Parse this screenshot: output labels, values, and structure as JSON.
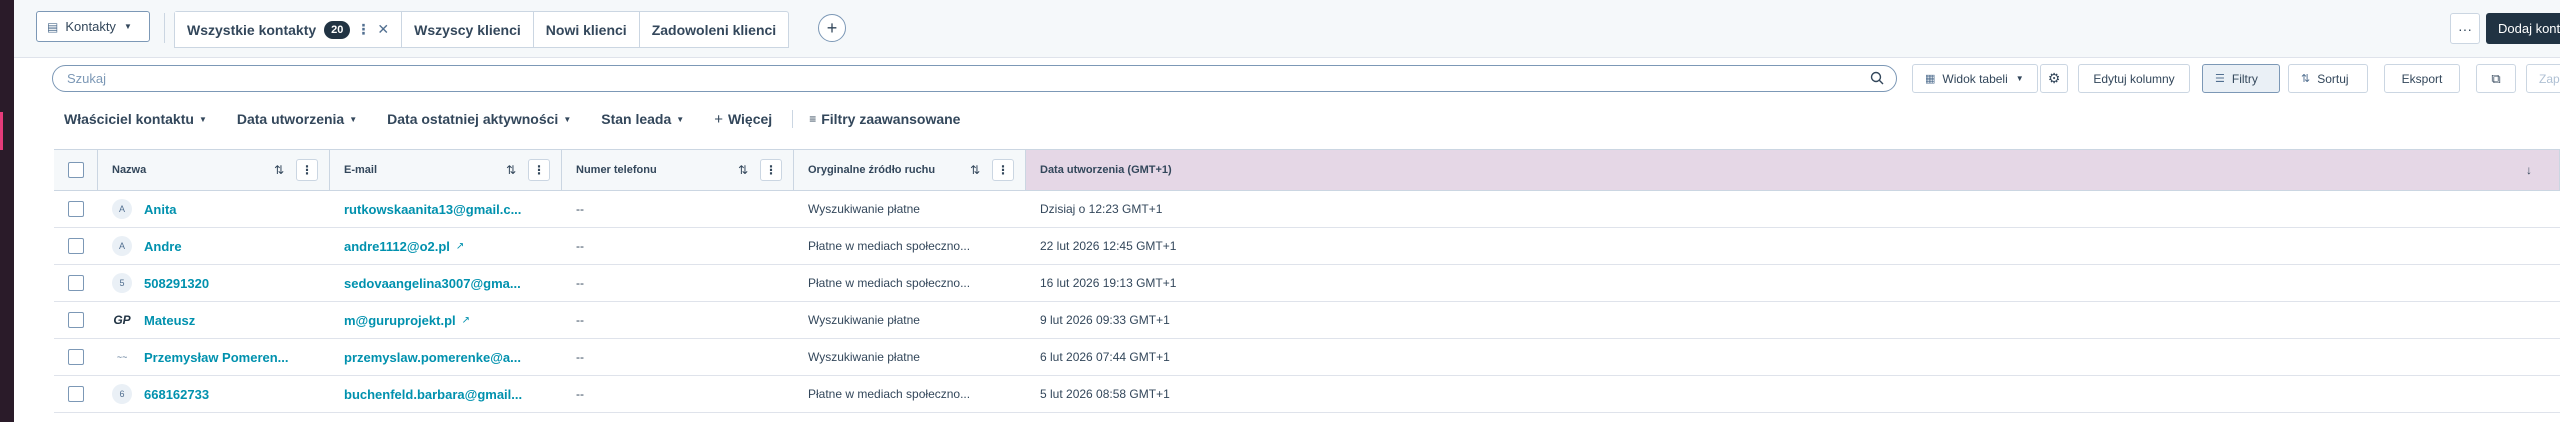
{
  "object_selector": {
    "label": "Kontakty"
  },
  "tabs": [
    {
      "label": "Wszystkie kontakty",
      "count": "20"
    },
    {
      "label": "Wszyscy klienci"
    },
    {
      "label": "Nowi klienci"
    },
    {
      "label": "Zadowoleni klienci"
    }
  ],
  "header_actions": {
    "add_tab": "+",
    "more": "···",
    "add_contact": "Dodaj kontakt"
  },
  "search": {
    "placeholder": "Szukaj"
  },
  "toolbar": {
    "table_view": "Widok tabeli",
    "edit_columns": "Edytuj kolumny",
    "filters": "Filtry",
    "sort": "Sortuj",
    "export": "Eksport",
    "save": "Zap"
  },
  "filters": [
    {
      "label": "Właściciel kontaktu"
    },
    {
      "label": "Data utworzenia"
    },
    {
      "label": "Data ostatniej aktywności"
    },
    {
      "label": "Stan leada"
    },
    {
      "label": "Więcej"
    },
    {
      "label": "Filtry zaawansowane"
    }
  ],
  "columns": [
    {
      "label": "Nazwa"
    },
    {
      "label": "E-mail"
    },
    {
      "label": "Numer telefonu"
    },
    {
      "label": "Oryginalne źródło ruchu"
    },
    {
      "label": "Data utworzenia (GMT+1)"
    }
  ],
  "rows": [
    {
      "avatar": "A",
      "name": "Anita",
      "email": "rutkowskaanita13@gmail.c...",
      "phone": "--",
      "source": "Wyszukiwanie płatne",
      "created": "Dzisiaj o 12:23 GMT+1"
    },
    {
      "avatar": "A",
      "name": "Andre",
      "email": "andre1112@o2.pl",
      "phone": "--",
      "source": "Płatne w mediach społeczno...",
      "created": "22 lut 2026 12:45 GMT+1"
    },
    {
      "avatar": "5",
      "name": "508291320",
      "email": "sedovaangelina3007@gma...",
      "phone": "--",
      "source": "Płatne w mediach społeczno...",
      "created": "16 lut 2026 19:13 GMT+1"
    },
    {
      "avatar": "GP",
      "name": "Mateusz",
      "email": "m@guruprojekt.pl",
      "phone": "--",
      "source": "Wyszukiwanie płatne",
      "created": "9 lut 2026 09:33 GMT+1"
    },
    {
      "avatar": "",
      "name": "Przemysław Pomeren...",
      "email": "przemyslaw.pomerenke@a...",
      "phone": "--",
      "source": "Wyszukiwanie płatne",
      "created": "6 lut 2026 07:44 GMT+1"
    },
    {
      "avatar": "6",
      "name": "668162733",
      "email": "buchenfeld.barbara@gmail...",
      "phone": "--",
      "source": "Płatne w mediach społeczno...",
      "created": "5 lut 2026 08:58 GMT+1"
    }
  ],
  "colors": {
    "accent_dark": "#213343",
    "link": "#0091ae",
    "sorted_header": "#e5d7e6",
    "brand_strip": "#2a1b29"
  }
}
